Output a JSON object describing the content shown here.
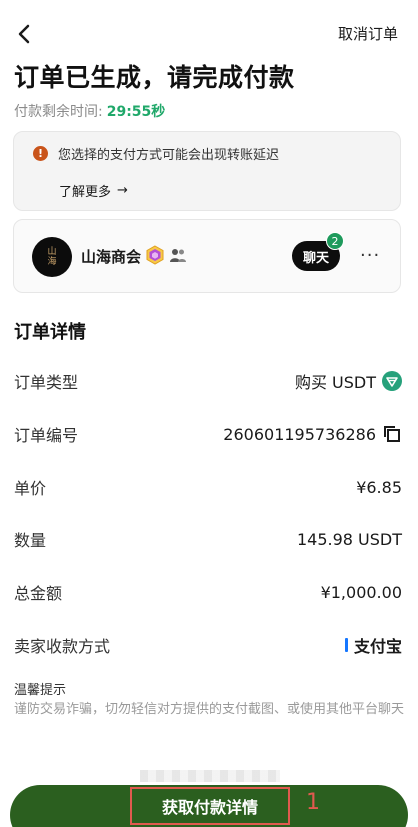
{
  "header": {
    "cancel_label": "取消订单",
    "title": "订单已生成，请完成付款"
  },
  "timer": {
    "label": "付款剩余时间:",
    "value": "29:55秒"
  },
  "notice": {
    "text": "您选择的支付方式可能会出现转账延迟",
    "learn_more": "了解更多",
    "learn_more_arrow": "→"
  },
  "merchant": {
    "avatar_text": "山\n海",
    "name": "山海商会",
    "chat_label": "聊天",
    "chat_count": "2",
    "more": "···"
  },
  "details": {
    "section_title": "订单详情",
    "rows": [
      {
        "label": "订单类型",
        "value": "购买 USDT"
      },
      {
        "label": "订单编号",
        "value": "260601195736286"
      },
      {
        "label": "单价",
        "value": "¥6.85"
      },
      {
        "label": "数量",
        "value": "145.98 USDT"
      },
      {
        "label": "总金额",
        "value": "¥1,000.00"
      },
      {
        "label": "卖家收款方式",
        "value": "支付宝"
      }
    ]
  },
  "tips": {
    "title": "温馨提示",
    "text": "谨防交易诈骗，切勿轻信对方提供的支付截图、或使用其他平台聊天"
  },
  "footer": {
    "primary_label": "获取付款详情",
    "step_number": "1"
  },
  "colors": {
    "accent_green": "#20a86a",
    "primary_button": "#2b5f1f",
    "warning": "#c9541a",
    "annotation_red": "#e05a4f",
    "alipay_blue": "#1677ff",
    "usdt_green": "#26a17b"
  }
}
